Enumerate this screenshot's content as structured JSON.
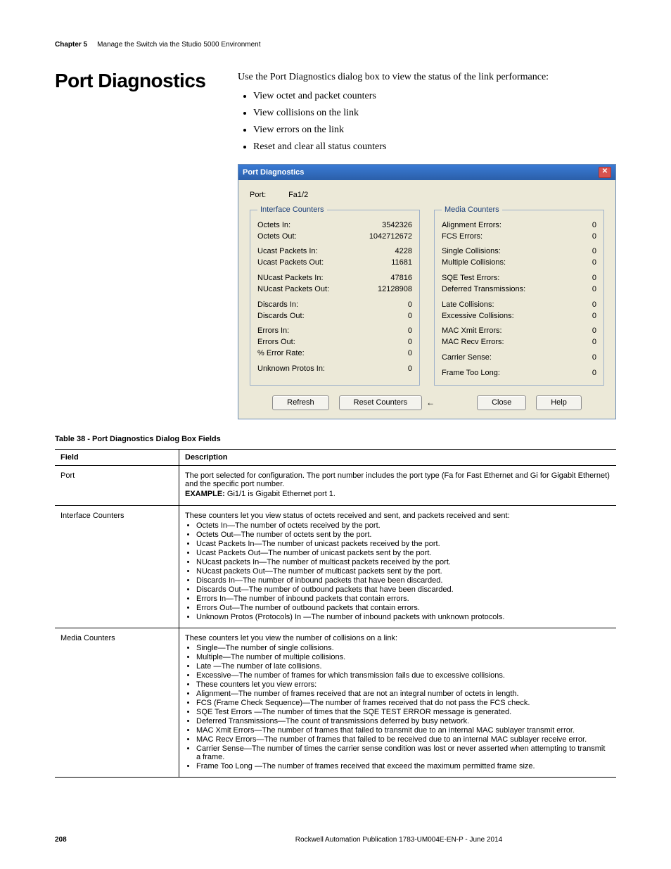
{
  "header": {
    "chapter": "Chapter 5",
    "subtitle": "Manage the Switch via the Studio 5000 Environment"
  },
  "section_title": "Port Diagnostics",
  "intro": "Use the Port Diagnostics dialog box to view the status of the link performance:",
  "intro_bullets": [
    "View octet and packet counters",
    "View collisions on the link",
    "View errors on the link",
    "Reset and clear all status counters"
  ],
  "dialog": {
    "title": "Port Diagnostics",
    "port_label": "Port:",
    "port_value": "Fa1/2",
    "interface_legend": "Interface Counters",
    "media_legend": "Media Counters",
    "interface": [
      {
        "k": "Octets In:",
        "v": "3542326"
      },
      {
        "k": "Octets Out:",
        "v": "1042712672"
      },
      {
        "k": "Ucast Packets In:",
        "v": "4228",
        "gap": true
      },
      {
        "k": "Ucast Packets Out:",
        "v": "11681"
      },
      {
        "k": "NUcast Packets In:",
        "v": "47816",
        "gap": true
      },
      {
        "k": "NUcast Packets Out:",
        "v": "12128908"
      },
      {
        "k": "Discards In:",
        "v": "0",
        "gap": true
      },
      {
        "k": "Discards Out:",
        "v": "0"
      },
      {
        "k": "Errors In:",
        "v": "0",
        "gap": true
      },
      {
        "k": "Errors Out:",
        "v": "0"
      },
      {
        "k": "% Error Rate:",
        "v": "0"
      },
      {
        "k": "Unknown Protos In:",
        "v": "0",
        "gap": true
      }
    ],
    "media": [
      {
        "k": "Alignment Errors:",
        "v": "0"
      },
      {
        "k": "FCS Errors:",
        "v": "0"
      },
      {
        "k": "Single Collisions:",
        "v": "0",
        "gap": true
      },
      {
        "k": "Multiple Collisions:",
        "v": "0"
      },
      {
        "k": "SQE Test Errors:",
        "v": "0",
        "gap": true
      },
      {
        "k": "Deferred Transmissions:",
        "v": "0"
      },
      {
        "k": "Late Collisions:",
        "v": "0",
        "gap": true
      },
      {
        "k": "Excessive Collisions:",
        "v": "0"
      },
      {
        "k": "MAC Xmit Errors:",
        "v": "0",
        "gap": true
      },
      {
        "k": "MAC Recv Errors:",
        "v": "0"
      },
      {
        "k": "Carrier Sense:",
        "v": "0",
        "gap": true
      },
      {
        "k": "Frame Too Long:",
        "v": "0",
        "gap": true
      }
    ],
    "buttons": {
      "refresh": "Refresh",
      "reset": "Reset Counters",
      "close": "Close",
      "help": "Help"
    }
  },
  "table_caption": "Table 38 - Port Diagnostics Dialog Box Fields",
  "table": {
    "head_field": "Field",
    "head_desc": "Description",
    "rows": [
      {
        "field": "Port",
        "desc_lines": [
          "The port selected for configuration. The port number includes the port type (Fa for Fast Ethernet and Gi for Gigabit Ethernet) and the specific port number."
        ],
        "example_label": "EXAMPLE:",
        "example_text": " Gi1/1 is Gigabit Ethernet port 1."
      },
      {
        "field": "Interface Counters",
        "desc_lines": [
          "These counters let you view status of octets received and sent, and packets received and sent:"
        ],
        "bullets": [
          "Octets In—The number of octets received by the port.",
          "Octets Out—The number of octets sent by the port.",
          "Ucast Packets In—The number of unicast packets received by the port.",
          "Ucast Packets Out—The number of unicast packets sent by the port.",
          "NUcast packets In—The number of multicast packets received by the port.",
          "NUcast packets Out—The number of multicast packets sent by the port.",
          "Discards In—The number of inbound packets that have been discarded.",
          "Discards Out—The number of outbound packets that have been discarded.",
          "Errors In—The number of inbound packets that contain errors.",
          "Errors Out—The number of outbound packets that contain errors.",
          "Unknown Protos (Protocols) In —The number of inbound packets with unknown protocols."
        ]
      },
      {
        "field": "Media Counters",
        "desc_lines": [
          "These counters let you view the number of collisions on a link:"
        ],
        "bullets": [
          "Single—The number of single collisions.",
          "Multiple—The number of multiple collisions.",
          "Late —The number of late collisions.",
          "Excessive—The number of frames for which transmission fails due to excessive collisions.",
          "These counters let you view errors:",
          "Alignment—The number of frames received that are not an integral number of octets in length.",
          "FCS (Frame Check Sequence)—The number of frames received that do not pass the FCS check.",
          "SQE Test Errors —The number of times that the SQE TEST ERROR message is generated.",
          "Deferred Transmissions—The count of transmissions deferred by busy network.",
          "MAC Xmit Errors—The number of frames that failed to transmit due to an internal MAC sublayer transmit error.",
          "MAC Recv Errors—The number of frames that failed to be received due to an internal MAC sublayer receive error.",
          "Carrier Sense—The number of times the carrier sense condition was lost or never asserted when attempting to transmit a frame.",
          "Frame Too Long —The number of frames received that exceed the maximum permitted frame size."
        ]
      }
    ]
  },
  "footer": {
    "page": "208",
    "pub": "Rockwell Automation Publication 1783-UM004E-EN-P - June 2014"
  }
}
